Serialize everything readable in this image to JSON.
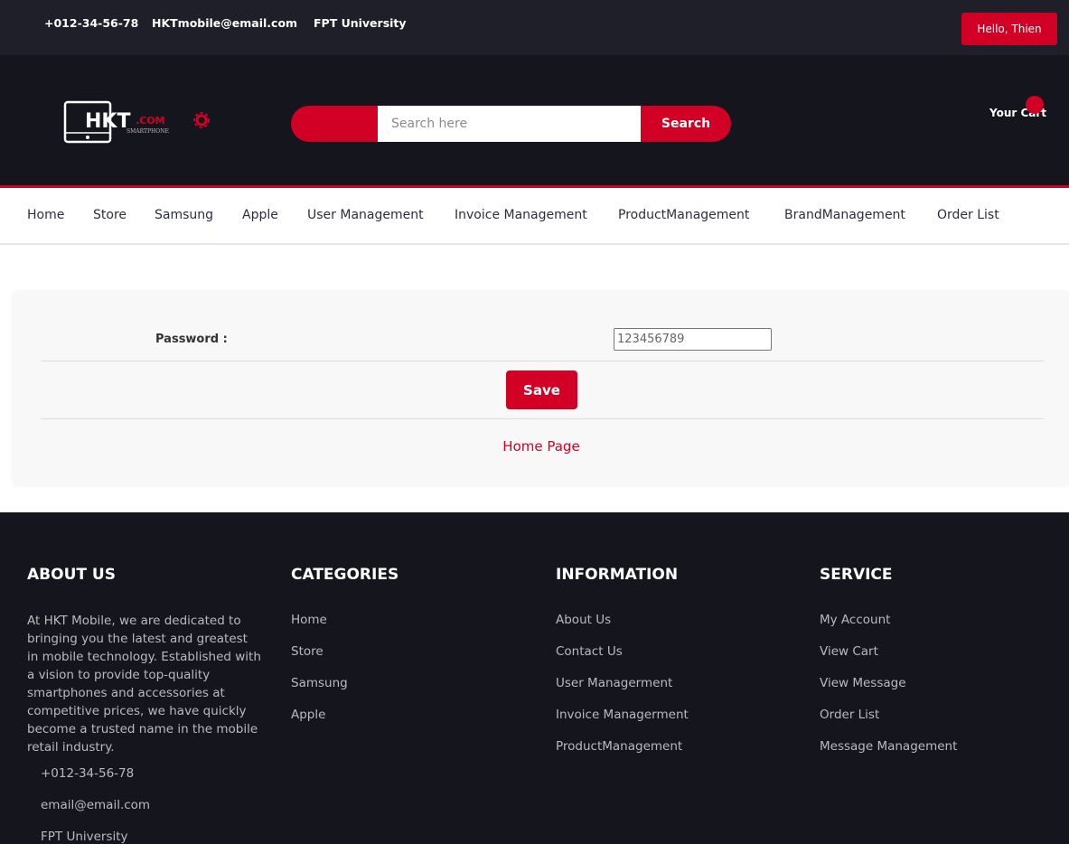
{
  "topbar": {
    "phone": "+012-34-56-78",
    "email": "HKTmobile@email.com",
    "location": "FPT University",
    "greeting": "Hello, Thien"
  },
  "header": {
    "logo_text": "HKT",
    "logo_suffix": ".COM",
    "logo_sub": "SMARTPHONE",
    "search_placeholder": "Search here",
    "search_button": "Search",
    "cart_label": "Your Cart"
  },
  "nav": {
    "items": [
      "Home",
      "Store",
      "Samsung",
      "Apple",
      "User Management",
      "Invoice Management",
      "ProductManagement",
      "BrandManagement",
      "Order List"
    ]
  },
  "form": {
    "password_label": "Password :",
    "password_value": "123456789",
    "save_button": "Save",
    "home_link": "Home Page"
  },
  "footer": {
    "about": {
      "title": "ABOUT US",
      "text": "At HKT Mobile, we are dedicated to bringing you the latest and greatest in mobile technology. Established with a vision to provide top-quality smartphones and accessories at competitive prices, we have quickly become a trusted name in the mobile retail industry.",
      "phone": "+012-34-56-78",
      "email": "email@email.com",
      "location": "FPT University"
    },
    "categories": {
      "title": "CATEGORIES",
      "links": [
        "Home",
        "Store",
        "Samsung",
        "Apple"
      ]
    },
    "information": {
      "title": "INFORMATION",
      "links": [
        "About Us",
        "Contact Us",
        "User Managerment",
        "Invoice Managerment",
        "ProductManagement"
      ]
    },
    "service": {
      "title": "SERVICE",
      "links": [
        "My Account",
        "View Cart",
        "View Message",
        "Order List",
        "Message Management"
      ]
    }
  },
  "colors": {
    "accent": "#d10024",
    "topbar_bg": "#1e1f29",
    "header_bg": "#15161d"
  }
}
